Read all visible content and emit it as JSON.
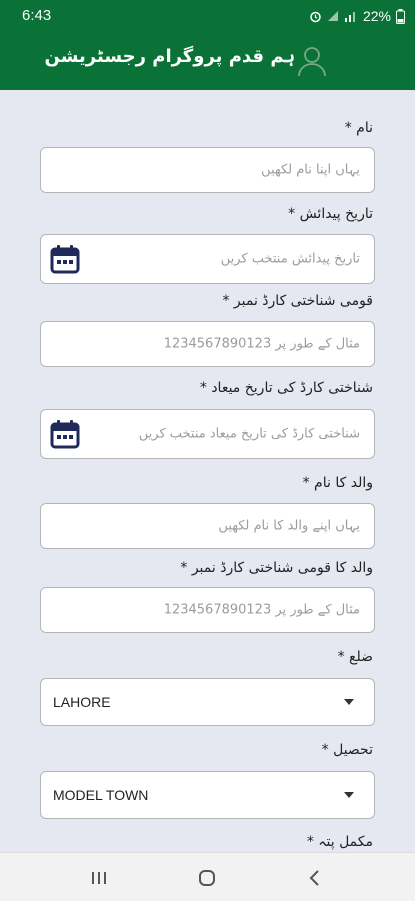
{
  "status": {
    "time": "6:43",
    "battery": "22%"
  },
  "header": {
    "title": "ہم قدم پروگرام رجسٹریشن"
  },
  "form": {
    "name_label": "نام *",
    "name_placeholder": "یہاں اپنا نام لکھیں",
    "dob_label": "تاریخ پیدائش *",
    "dob_placeholder": "تاریخ پیدائش منتخب کریں",
    "cnic_label": "قومی شناختی کارڈ نمبر *",
    "cnic_placeholder": "مثال کے طور پر 1234567890123",
    "cnic_expiry_label": "شناختی کارڈ کی تاریخ میعاد *",
    "cnic_expiry_placeholder": "شناختی کارڈ کی تاریخ میعاد منتخب کریں",
    "father_name_label": "والد کا نام *",
    "father_name_placeholder": "یہاں اپنے والد کا نام لکھیں",
    "father_cnic_label": "والد کا قومی شناختی کارڈ نمبر *",
    "father_cnic_placeholder": "مثال کے طور پر 1234567890123",
    "district_label": "ضلع *",
    "district_value": "LAHORE",
    "tehsil_label": "تحصیل *",
    "tehsil_value": "MODEL TOWN",
    "address_label": "مکمل پتہ *"
  },
  "colors": {
    "primary": "#0a7236",
    "background": "#e6e8f1",
    "icon": "#1f2a5a"
  }
}
